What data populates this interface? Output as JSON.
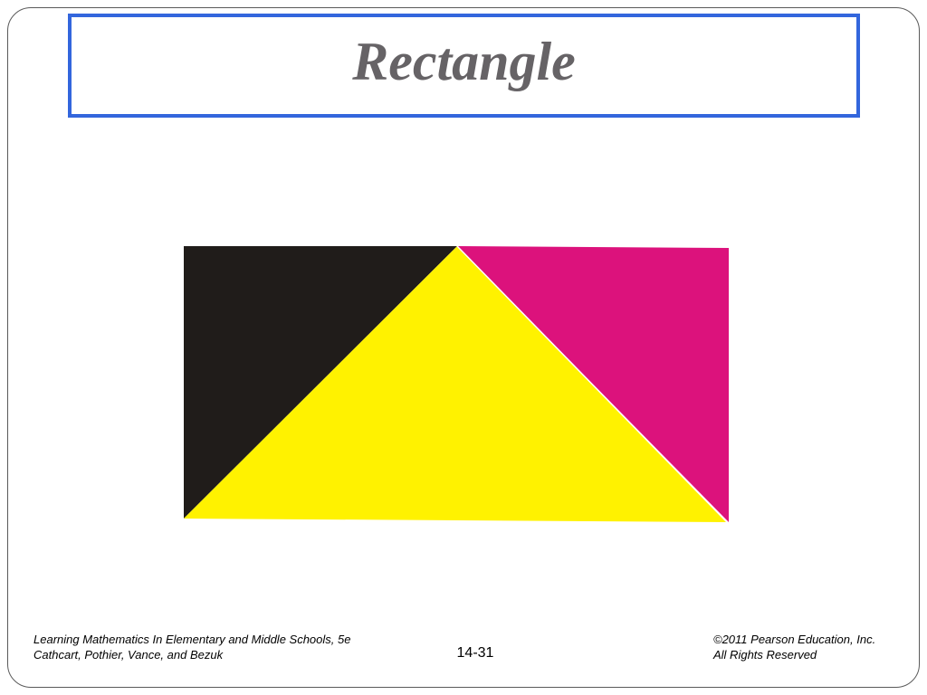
{
  "slide": {
    "title": "Rectangle"
  },
  "figure": {
    "colors": {
      "left_triangle": "#201c1a",
      "middle_triangle": "#fff200",
      "right_triangle": "#dc127c"
    }
  },
  "footer": {
    "left_line1": "Learning Mathematics In Elementary and Middle Schools, 5e",
    "left_line2": "Cathcart, Pothier, Vance, and Bezuk",
    "page_number": "14-31",
    "right_line1": "©2011 Pearson Education, Inc.",
    "right_line2": "All Rights Reserved"
  }
}
